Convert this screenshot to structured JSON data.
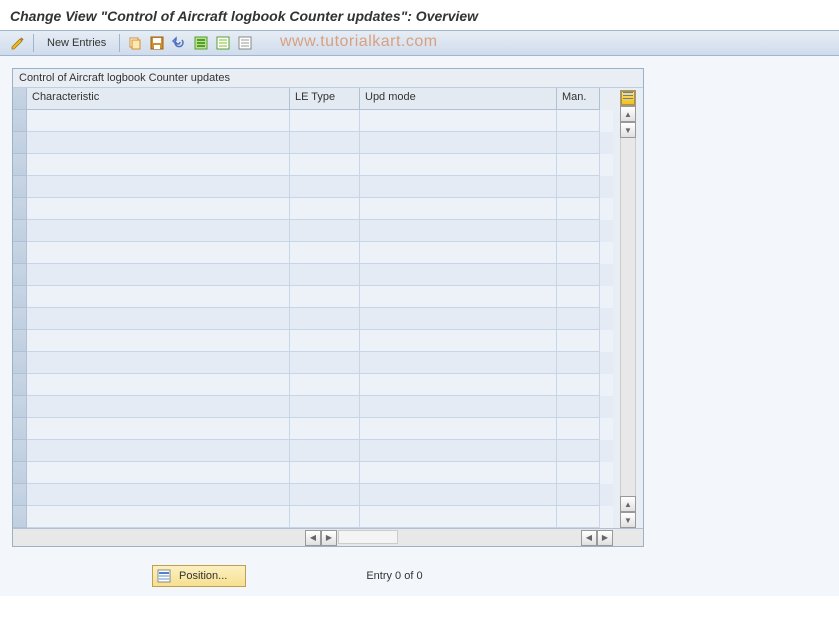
{
  "title": "Change View \"Control of Aircraft logbook Counter updates\": Overview",
  "toolbar": {
    "new_entries": "New Entries"
  },
  "watermark": "www.tutorialkart.com",
  "panel": {
    "title": "Control of Aircraft logbook Counter updates",
    "columns": {
      "characteristic": "Characteristic",
      "le_type": "LE Type",
      "upd_mode": "Upd mode",
      "man": "Man."
    }
  },
  "footer": {
    "position_label": "Position...",
    "entry_text": "Entry 0 of 0"
  }
}
